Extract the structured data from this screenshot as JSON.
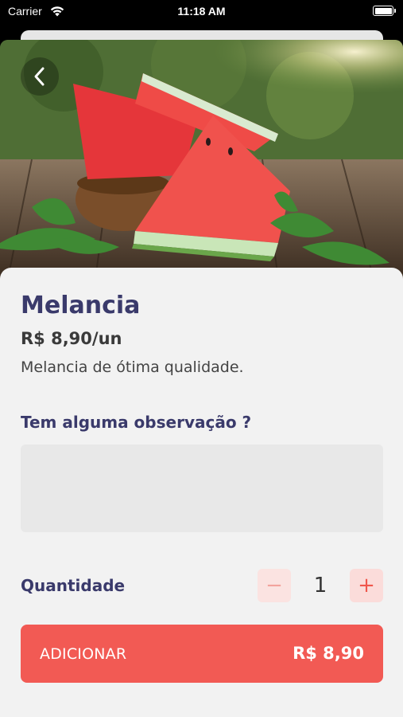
{
  "status_bar": {
    "carrier": "Carrier",
    "time": "11:18 AM"
  },
  "product": {
    "name": "Melancia",
    "price": "R$ 8,90/un",
    "description": "Melancia de ótima qualidade."
  },
  "observation": {
    "label": "Tem alguma observação ?",
    "value": "",
    "placeholder": ""
  },
  "quantity": {
    "label": "Quantidade",
    "value": "1",
    "minus": "−",
    "plus": "+"
  },
  "add_button": {
    "label": "ADICIONAR",
    "total": "R$ 8,90"
  },
  "colors": {
    "accent": "#f25a54",
    "title": "#3a3a6b",
    "background": "#f2f2f2"
  },
  "icons": {
    "back": "chevron-left-icon",
    "wifi": "wifi-icon",
    "battery": "battery-icon"
  }
}
